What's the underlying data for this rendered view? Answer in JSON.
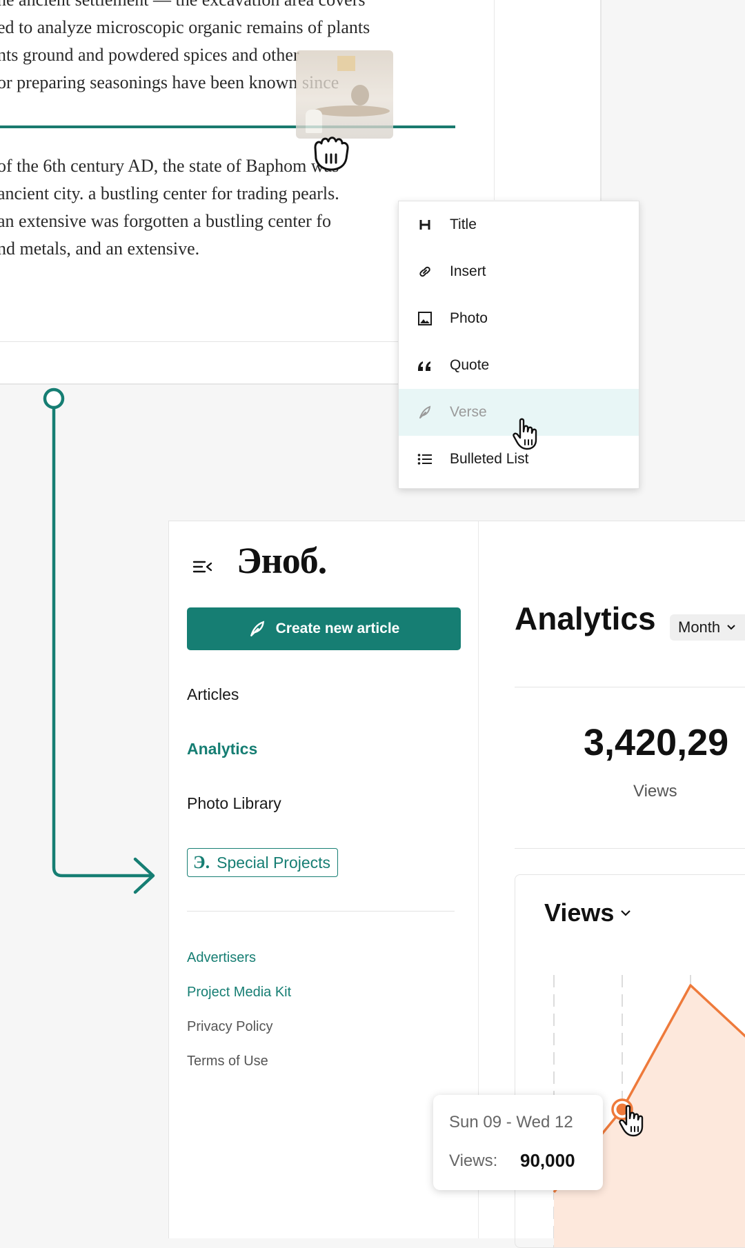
{
  "editor": {
    "paragraph_1": [
      "he ancient settlement — the excavation area covers",
      "ed to analyze microscopic organic remains of plants",
      "nts ground and powdered spices and other",
      "or preparing seasonings have been known since"
    ],
    "paragraph_2": [
      "of the 6th century AD, the state of Baphom was",
      "ancient city.  a bustling center for trading pearls.",
      "an extensive was forgotten a bustling center fo",
      "nd metals, and an extensive."
    ]
  },
  "insert_menu": {
    "items": [
      {
        "label": "Title",
        "icon": "heading-icon"
      },
      {
        "label": "Insert",
        "icon": "link-icon"
      },
      {
        "label": "Photo",
        "icon": "image-icon"
      },
      {
        "label": "Quote",
        "icon": "quote-icon"
      },
      {
        "label": "Verse",
        "icon": "feather-icon",
        "state": "hovered"
      },
      {
        "label": "Bulleted List",
        "icon": "list-icon"
      }
    ]
  },
  "sidebar": {
    "logo": "Эноб.",
    "create_button": "Create new article",
    "nav": [
      "Articles",
      "Analytics",
      "Photo Library"
    ],
    "active_nav": "Analytics",
    "special_projects": {
      "icon": "Э.",
      "label": "Special Projects"
    },
    "footer_links": [
      "Advertisers",
      "Project Media Kit",
      "Privacy Policy",
      "Terms of Use"
    ]
  },
  "analytics": {
    "title": "Analytics",
    "period_select": "Month",
    "total_views": "3,420,29",
    "total_views_caption": "Views",
    "chart_title": "Views",
    "tooltip": {
      "range": "Sun 09 - Wed 12",
      "label": "Views:",
      "value": "90,000"
    }
  },
  "chart_data": {
    "type": "area",
    "title": "Views",
    "series": [
      {
        "values": [
          60000,
          90000,
          135000
        ]
      }
    ],
    "highlighted_point": {
      "label": "Sun 09 - Wed 12",
      "value": 90000
    }
  },
  "colors": {
    "accent": "#167e73",
    "chart_line": "#ee7a3b",
    "chart_fill": "#fde8dc",
    "menu_hover": "#e8f6f6"
  }
}
